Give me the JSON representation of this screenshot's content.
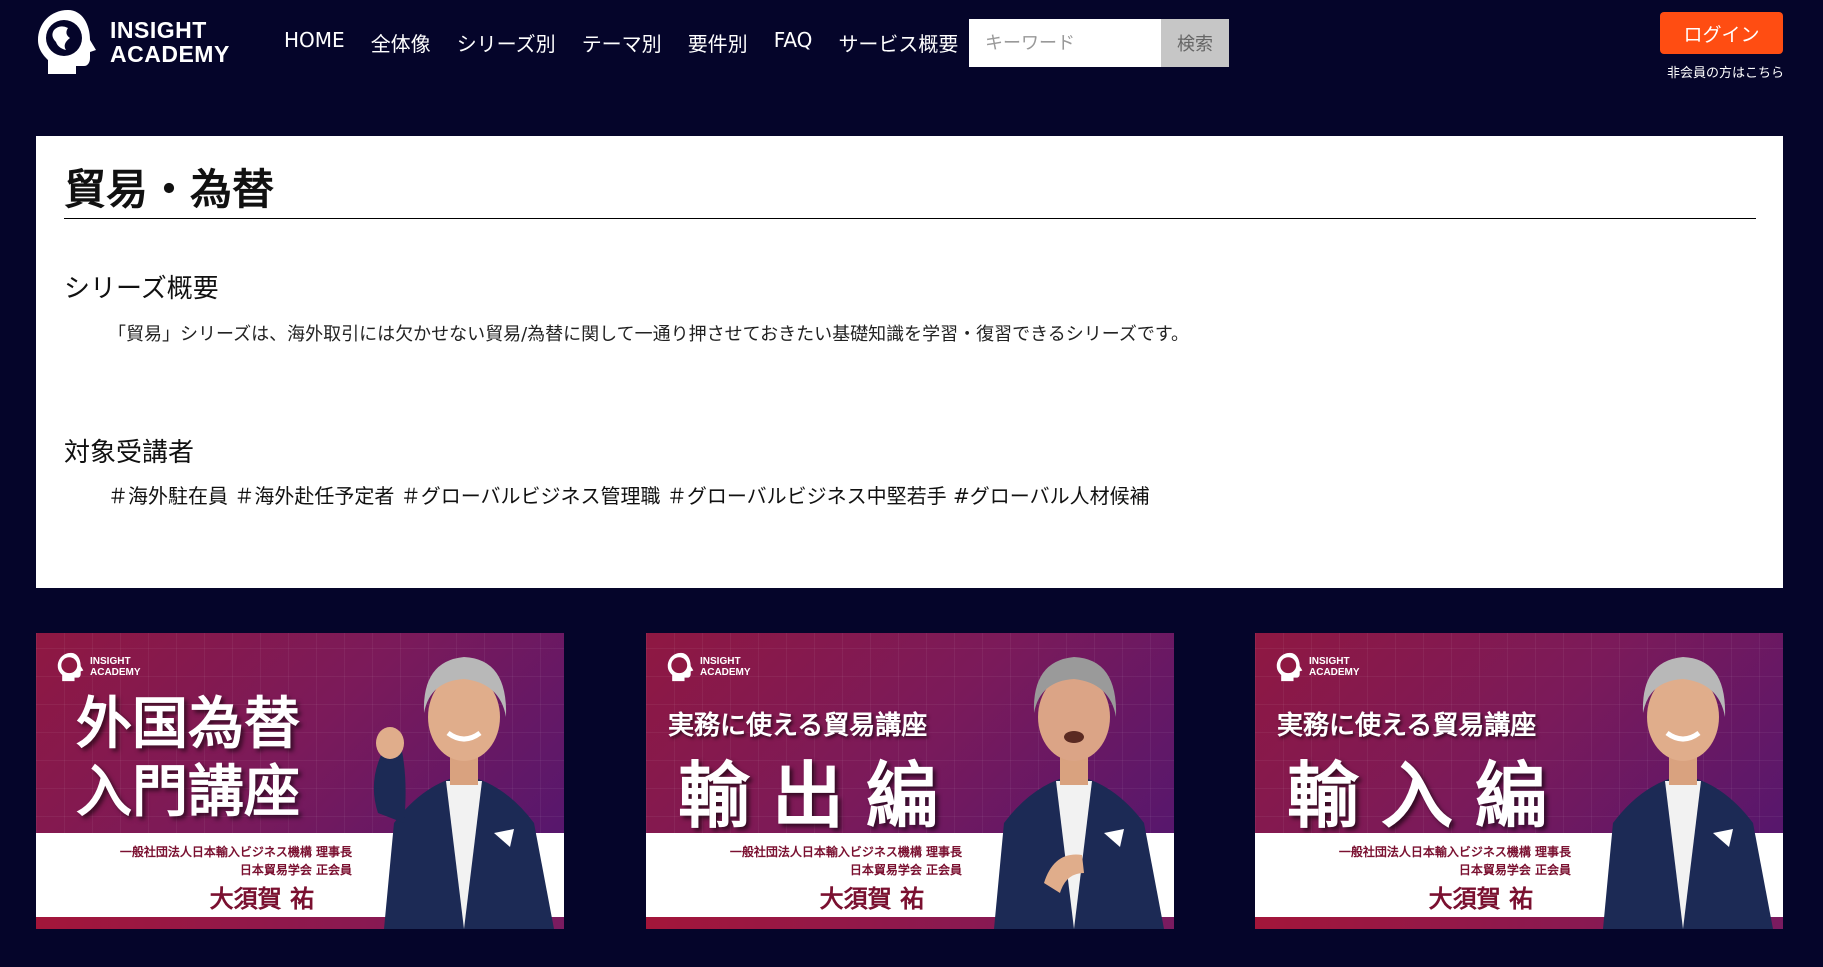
{
  "header": {
    "logo_line1": "INSIGHT",
    "logo_line2": "ACADEMY",
    "nav": [
      "HOME",
      "全体像",
      "シリーズ別",
      "テーマ別",
      "要件別",
      "FAQ",
      "サービス概要"
    ],
    "search_placeholder": "キーワード",
    "search_button": "検索",
    "login_button": "ログイン",
    "nonmember_link": "非会員の方はこちら"
  },
  "panel": {
    "title": "貿易・為替",
    "overview_heading": "シリーズ概要",
    "overview_text": "「貿易」シリーズは、海外取引には欠かせない貿易/為替に関して一通り押させておきたい基礎知識を学習・復習できるシリーズです。",
    "audience_heading": "対象受講者",
    "audience_tags": "＃海外駐在員 ＃海外赴任予定者 ＃グローバルビジネス管理職 ＃グローバルビジネス中堅若手 #グローバル人材候補"
  },
  "cards": [
    {
      "logo_line1": "INSIGHT",
      "logo_line2": "ACADEMY",
      "title_line1": "外国為替",
      "title_line2": "入門講座",
      "affiliation_line1": "一般社団法人日本輸入ビジネス機構 理事長",
      "affiliation_line2": "日本貿易学会 正会員",
      "name": "大須賀 祐"
    },
    {
      "logo_line1": "INSIGHT",
      "logo_line2": "ACADEMY",
      "subtitle": "実務に使える貿易講座",
      "big": "輸出編",
      "affiliation_line1": "一般社団法人日本輸入ビジネス機構 理事長",
      "affiliation_line2": "日本貿易学会 正会員",
      "name": "大須賀 祐"
    },
    {
      "logo_line1": "INSIGHT",
      "logo_line2": "ACADEMY",
      "subtitle": "実務に使える貿易講座",
      "big": "輸入編",
      "affiliation_line1": "一般社団法人日本輸入ビジネス機構 理事長",
      "affiliation_line2": "日本貿易学会 正会員",
      "name": "大須賀 祐"
    }
  ],
  "colors": {
    "background": "#05052a",
    "login_accent": "#ff4d12",
    "card_primary": "#8f1842"
  }
}
